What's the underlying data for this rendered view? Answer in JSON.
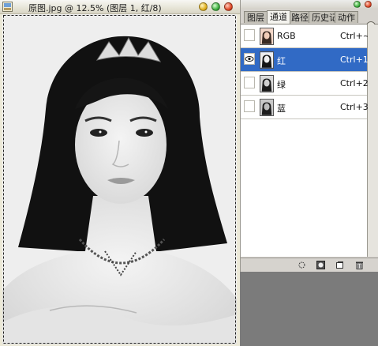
{
  "document": {
    "title": "原图.jpg @ 12.5% (图层 1, 红/8)",
    "icon": "photoshop-doc-icon"
  },
  "panel": {
    "tabs": [
      {
        "label": "图层",
        "active": false
      },
      {
        "label": "通道",
        "active": true
      },
      {
        "label": "路径",
        "active": false
      },
      {
        "label": "历史记录",
        "active": false
      },
      {
        "label": "动作",
        "active": false
      }
    ],
    "menu_icon": "panel-menu-arrow-icon",
    "channels": [
      {
        "name": "RGB",
        "shortcut": "Ctrl+~",
        "visible": false,
        "selected": false
      },
      {
        "name": "红",
        "shortcut": "Ctrl+1",
        "visible": true,
        "selected": true
      },
      {
        "name": "绿",
        "shortcut": "Ctrl+2",
        "visible": false,
        "selected": false
      },
      {
        "name": "蓝",
        "shortcut": "Ctrl+3",
        "visible": false,
        "selected": false
      }
    ],
    "footer_icons": [
      "load-selection-icon",
      "save-selection-icon",
      "new-channel-icon",
      "trash-icon"
    ]
  },
  "colors": {
    "selection_highlight": "#316ac5",
    "workspace_gray": "#7b7b7b",
    "panel_bg": "#d6d3ce"
  }
}
